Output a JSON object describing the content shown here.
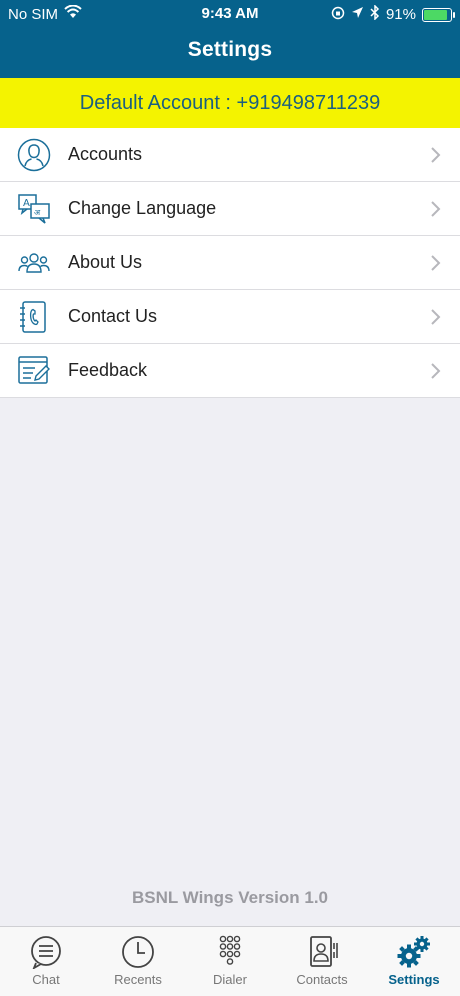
{
  "status_bar": {
    "carrier": "No SIM",
    "time": "9:43 AM",
    "battery": "91%",
    "battery_level": 0.91
  },
  "header": {
    "title": "Settings"
  },
  "account": {
    "text": "Default Account : +919498711239"
  },
  "menu": {
    "items": [
      {
        "label": "Accounts",
        "icon": "person-icon"
      },
      {
        "label": "Change Language",
        "icon": "language-icon"
      },
      {
        "label": "About Us",
        "icon": "group-icon"
      },
      {
        "label": "Contact Us",
        "icon": "phone-book-icon"
      },
      {
        "label": "Feedback",
        "icon": "feedback-icon"
      }
    ]
  },
  "footer": {
    "version": "BSNL Wings Version 1.0"
  },
  "tabs": [
    {
      "label": "Chat",
      "icon": "chat-icon",
      "active": false
    },
    {
      "label": "Recents",
      "icon": "clock-icon",
      "active": false
    },
    {
      "label": "Dialer",
      "icon": "dialpad-icon",
      "active": false
    },
    {
      "label": "Contacts",
      "icon": "contacts-icon",
      "active": false
    },
    {
      "label": "Settings",
      "icon": "gears-icon",
      "active": true
    }
  ],
  "colors": {
    "header": "#06628c",
    "account_bar": "#f4f300",
    "account_text": "#1b5f80",
    "icon": "#1b6f9a",
    "active_tab": "#06628c"
  }
}
